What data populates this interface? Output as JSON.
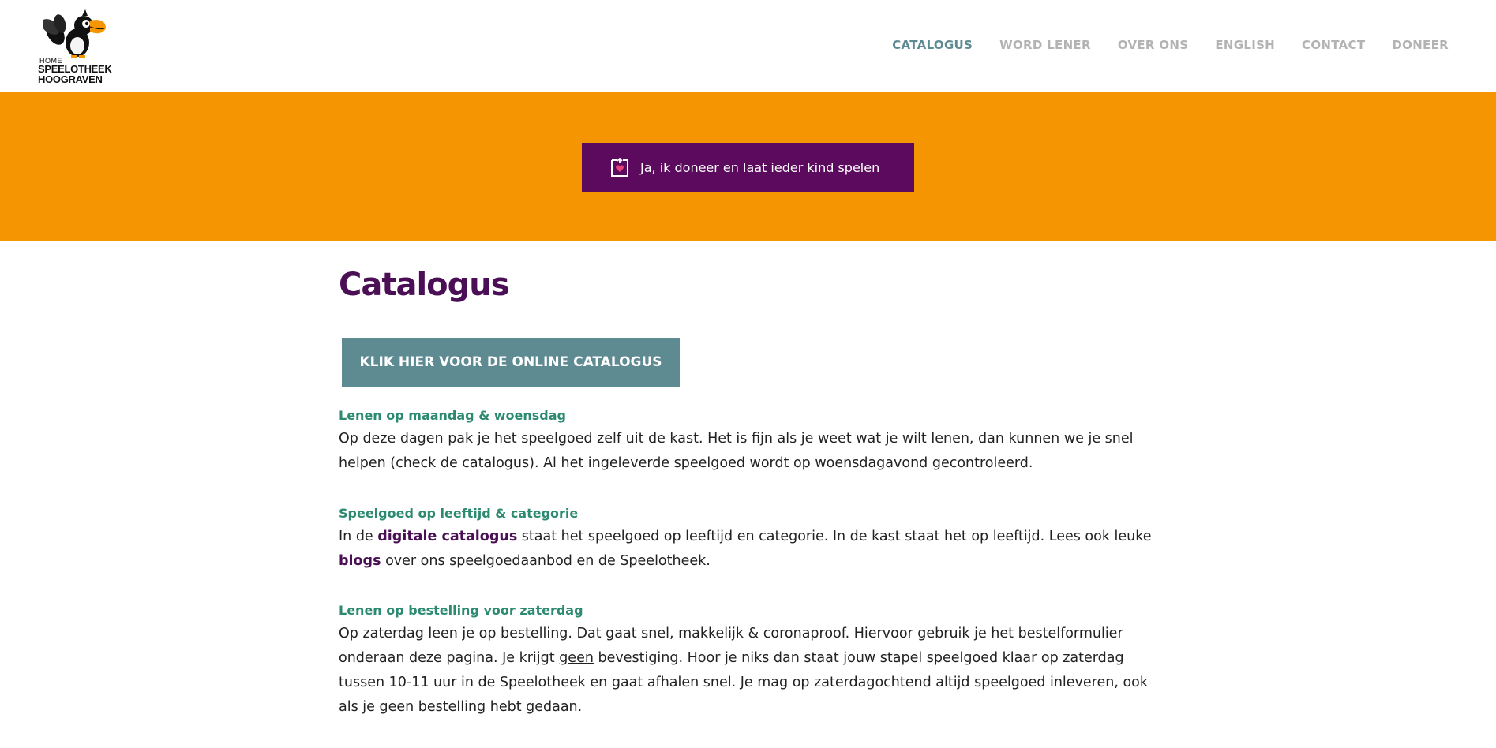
{
  "header": {
    "logo": {
      "home_label": "HOME",
      "line1": "SPEELOTHEEK",
      "line2": "HOOGRAVEN"
    },
    "nav": [
      {
        "label": "CATALOGUS",
        "active": true
      },
      {
        "label": "WORD LENER",
        "active": false
      },
      {
        "label": "OVER ONS",
        "active": false
      },
      {
        "label": "ENGLISH",
        "active": false
      },
      {
        "label": "CONTACT",
        "active": false
      },
      {
        "label": "DONEER",
        "active": false
      }
    ]
  },
  "banner": {
    "background": "#f59502",
    "donate_button": {
      "label": "Ja, ik doneer en laat ieder kind spelen",
      "icon": "donate-heart-icon",
      "color": "#5b0a5d"
    }
  },
  "main": {
    "title": "Catalogus",
    "catalog_button": "KLIK HIER VOOR DE ONLINE CATALOGUS",
    "sections": [
      {
        "heading": "Lenen op maandag & woensdag",
        "text": "Op deze dagen pak je het speelgoed zelf uit de kast. Het is fijn als je weet wat je wilt lenen, dan kunnen we je snel helpen (check de catalogus). Al het ingeleverde speelgoed wordt op woensdagavond gecontroleerd."
      },
      {
        "heading": "Speelgoed op leeftijd & categorie",
        "text_before": "In de ",
        "link1": "digitale catalogus",
        "text_middle": " staat het speelgoed op leeftijd en categorie. In de kast staat het op leeftijd. Lees ook leuke ",
        "link2": "blogs",
        "text_after": " over ons speelgoedaanbod en de Speelotheek."
      },
      {
        "heading": "Lenen op bestelling voor zaterdag",
        "text_before": "Op zaterdag leen je op bestelling. Dat gaat snel, makkelijk & coronaproof. Hiervoor gebruik je het bestelformulier onderaan deze pagina. Je krijgt ",
        "underlined": "geen",
        "text_after": " bevestiging. Hoor je niks dan staat jouw stapel speelgoed klaar op zaterdag tussen 10-11 uur in de Speelotheek en gaat afhalen snel. Je mag op zaterdagochtend altijd speelgoed inleveren, ook als je geen bestelling hebt gedaan."
      }
    ]
  },
  "colors": {
    "accent_purple": "#4b0f56",
    "nav_active": "#5e8a92",
    "nav_inactive": "#b3b3b3",
    "section_heading": "#2b8a6f",
    "orange": "#f59502"
  }
}
